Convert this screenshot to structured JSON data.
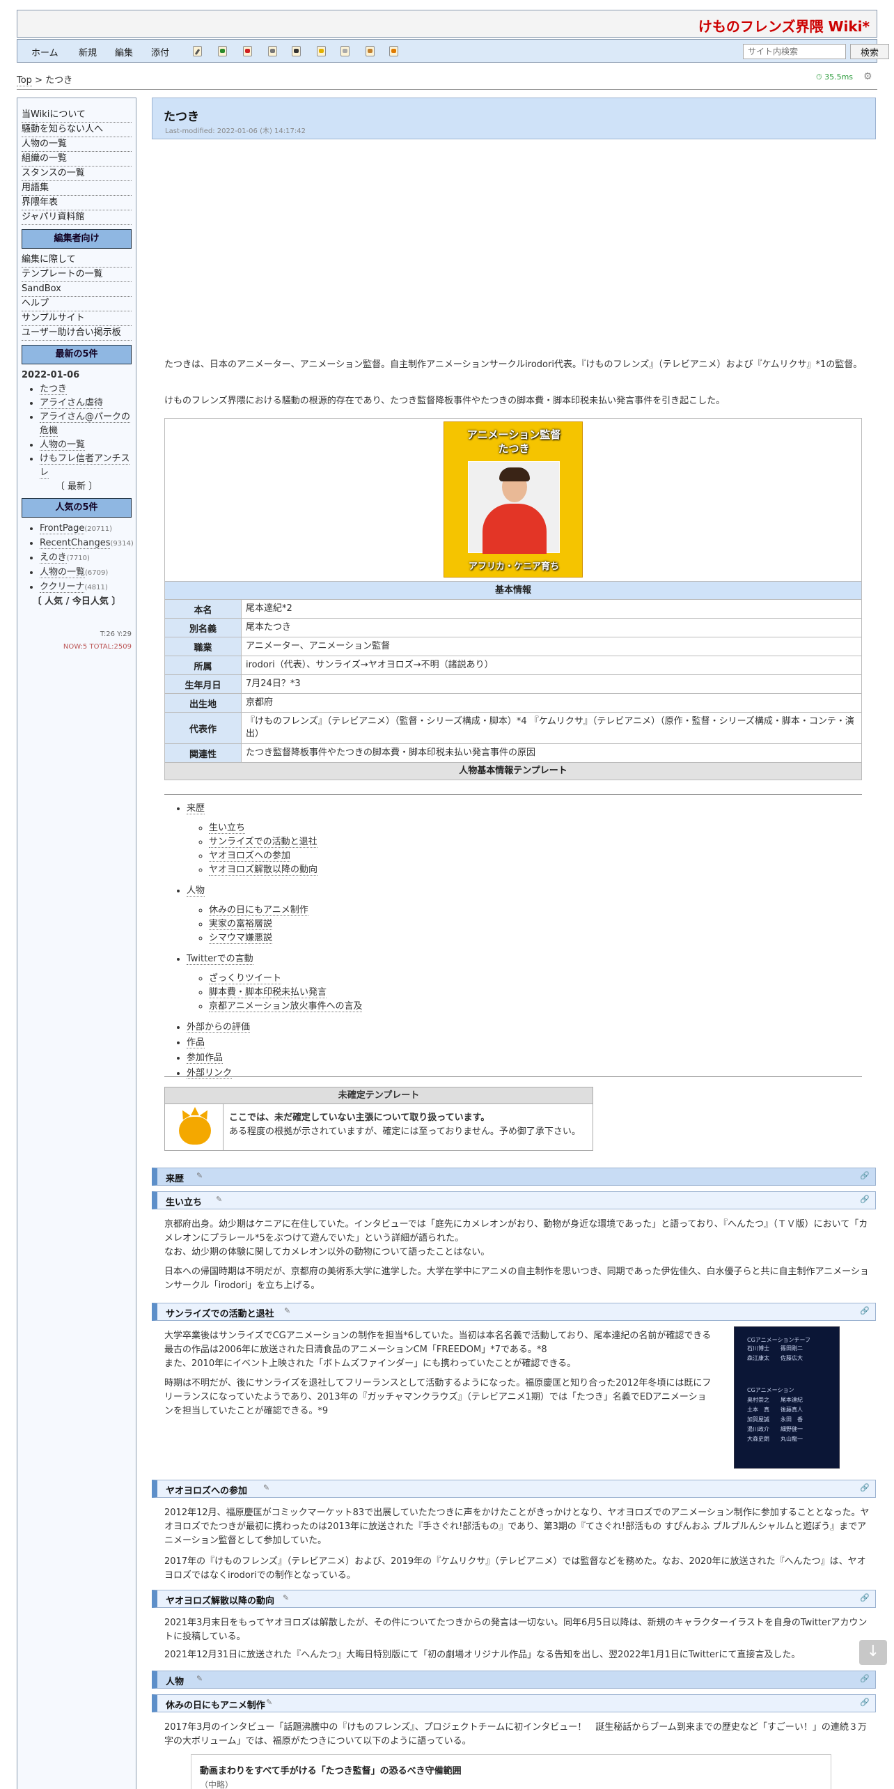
{
  "site": {
    "title": "けものフレンズ界隈 Wiki*"
  },
  "nav": {
    "home": "ホーム",
    "new": "新規",
    "edit": "編集",
    "attach": "添付",
    "search_placeholder": "サイト内検索",
    "search_button": "検索"
  },
  "breadcrumb": {
    "top": "Top",
    "sep": ">",
    "current": "たつき"
  },
  "perf": "35.5ms",
  "sidebar": {
    "links": [
      "当Wikiについて",
      "騒動を知らない人へ",
      "人物の一覧",
      "組織の一覧",
      "スタンスの一覧",
      "用語集",
      "界隈年表",
      "ジャパリ資料館"
    ],
    "editor_head": "編集者向け",
    "editor_links": [
      "編集に際して",
      "テンプレートの一覧",
      "SandBox",
      "ヘルプ",
      "サンプルサイト",
      "ユーザー助け合い掲示板"
    ],
    "latest_head": "最新の5件",
    "latest_date": "2022-01-06",
    "latest_items": [
      "たつき",
      "アライさん虐待",
      "アライさん@パークの危機",
      "人物の一覧",
      "けもフレ信者アンチスレ"
    ],
    "latest_more": "〔 最新 〕",
    "popular_head": "人気の5件",
    "popular_items": [
      {
        "name": "FrontPage",
        "count": "(20711)"
      },
      {
        "name": "RecentChanges",
        "count": "(9314)"
      },
      {
        "name": "えのき",
        "count": "(7710)"
      },
      {
        "name": "人物の一覧",
        "count": "(6709)"
      },
      {
        "name": "ククリーナ",
        "count": "(4811)"
      }
    ],
    "popular_more": "〔 人気 / 今日人気 〕",
    "counter1": "T:26 Y:29",
    "counter2": "NOW:5 TOTAL:2509"
  },
  "page": {
    "title": "たつき",
    "last_modified": "Last-modified: 2022-01-06 (木) 14:17:42",
    "intro1": "たつきは、日本のアニメーター、アニメーション監督。自主制作アニメーションサークルirodori代表。『けものフレンズ』（テレビアニメ）および『ケムリクサ』*1の監督。",
    "intro2": "けものフレンズ界隈における騒動の根源的存在であり、たつき監督降板事件やたつきの脚本費・脚本印税未払い発言事件を引き起こした。"
  },
  "poster": {
    "line1": "アニメーション監督",
    "line2": "たつき",
    "bottom": "アフリカ・ケニア育ち"
  },
  "infobox": {
    "head": "基本情報",
    "rows": [
      {
        "k": "本名",
        "v": "尾本達紀*2"
      },
      {
        "k": "別名義",
        "v": "尾本たつき"
      },
      {
        "k": "職業",
        "v": "アニメーター、アニメーション監督"
      },
      {
        "k": "所属",
        "v": "irodori（代表）、サンライズ→ヤオヨロズ→不明（諸説あり）"
      },
      {
        "k": "生年月日",
        "v": "7月24日？*3"
      },
      {
        "k": "出生地",
        "v": "京都府"
      },
      {
        "k": "代表作",
        "v": "『けものフレンズ』（テレビアニメ）（監督・シリーズ構成・脚本）*4 『ケムリクサ』（テレビアニメ）（原作・監督・シリーズ構成・脚本・コンテ・演出）"
      },
      {
        "k": "関連性",
        "v": "たつき監督降板事件やたつきの脚本費・脚本印税未払い発言事件の原因"
      }
    ],
    "foot": "人物基本情報テンプレート"
  },
  "toc": [
    {
      "label": "来歴",
      "sub": [
        "生い立ち",
        "サンライズでの活動と退社",
        "ヤオヨロズへの参加",
        "ヤオヨロズ解散以降の動向"
      ]
    },
    {
      "label": "人物",
      "sub": [
        "休みの日にもアニメ制作",
        "実家の富裕層説",
        "シマウマ嫌悪説"
      ]
    },
    {
      "label": "Twitterでの言動",
      "sub": [
        "ざっくりツイート",
        "脚本費・脚本印税未払い発言",
        "京都アニメーション放火事件への言及"
      ]
    },
    {
      "label": "外部からの評価",
      "sub": []
    },
    {
      "label": "作品",
      "sub": []
    },
    {
      "label": "参加作品",
      "sub": []
    },
    {
      "label": "外部リンク",
      "sub": []
    }
  ],
  "unconfirmed": {
    "head": "未確定テンプレート",
    "bold": "ここでは、未だ確定していない主張について取り扱っています。",
    "text": "ある程度の根拠が示されていますが、確定には至っておりません。予め御了承下さい。"
  },
  "sections": {
    "raireki": "来歴",
    "oitachi": "生い立ち",
    "oitachi_p1": "京都府出身。幼少期はケニアに在住していた。インタビューでは「庭先にカメレオンがおり、動物が身近な環境であった」と語っており、『へんたつ』（ＴＶ版）において「カメレオンにプラレール*5をぶつけて遊んでいた」という詳細が語られた。",
    "oitachi_p2": "なお、幼少期の体験に関してカメレオン以外の動物について語ったことはない。",
    "oitachi_p3": "日本への帰国時期は不明だが、京都府の美術系大学に進学した。大学在学中にアニメの自主制作を思いつき、同期であった伊佐佳久、白水優子らと共に自主制作アニメーションサークル「irodori」を立ち上げる。",
    "sunrise": "サンライズでの活動と退社",
    "sunrise_p1": "大学卒業後はサンライズでCGアニメーションの制作を担当*6していた。当初は本名名義で活動しており、尾本達紀の名前が確認できる最古の作品は2006年に放送された日清食品のアニメーションCM「FREEDOM」*7である。*8",
    "sunrise_p2": "また、2010年にイベント上映された「ボトムズファインダー」にも携わっていたことが確認できる。",
    "sunrise_p3": "時期は不明だが、後にサンライズを退社してフリーランスとして活動するようになった。福原慶匡と知り合った2012年冬頃には既にフリーランスになっていたようであり、2013年の『ガッチャマンクラウズ』（テレビアニメ1期）では「たつき」名義でEDアニメーションを担当していたことが確認できる。*9",
    "yaoyorozu": "ヤオヨロズへの参加",
    "yaoyorozu_p1": "2012年12月、福原慶匡がコミックマーケット83で出展していたたつきに声をかけたことがきっかけとなり、ヤオヨロズでのアニメーション制作に参加することとなった。ヤオヨロズでたつきが最初に携わったのは2013年に放送された『手さぐれ!部活もの』であり、第3期の『てさぐれ!部活もの すぴんおふ プルプルんシャルムと遊ぼう』までアニメーション監督として参加していた。",
    "yaoyorozu_p2": "2017年の『けものフレンズ』（テレビアニメ）および、2019年の『ケムリクサ』（テレビアニメ）では監督などを務めた。なお、2020年に放送された『へんたつ』は、ヤオヨロズではなくirodoriでの制作となっている。",
    "after": "ヤオヨロズ解散以降の動向",
    "after_p1": "2021年3月末日をもってヤオヨロズは解散したが、その件についてたつきからの発言は一切ない。同年6月5日以降は、新規のキャラクターイラストを自身のTwitterアカウントに投稿している。",
    "after_p2": "2021年12月31日に放送された『へんたつ』大晦日特別版にて「初の劇場オリジナル作品」なる告知を出し、翌2022年1月1日にTwitterにて直接言及した。",
    "jinbutsu": "人物",
    "yasumi": "休みの日にもアニメ制作",
    "yasumi_p1": "2017年3月のインタビュー「話題沸騰中の『けものフレンズ』、プロジェクトチームに初インタビュー！　誕生秘話からブーム到来までの歴史など「すごーい！」の連続３万字の大ボリューム」では、福原がたつきについて以下のように語っている。",
    "quote_title": "動画まわりをすべて手がける「たつき監督」の恐るべき守備範囲",
    "quote_sub": "（中略）"
  },
  "credits": {
    "lines": [
      "CGアニメーションチーフ",
      "石川博士　　篠田剛二",
      "森江康太　　佐藤広大",
      "",
      "CGアニメーション",
      "奥村崇之　　尾本達紀",
      "土本　真　　後藤真人",
      "加賀屋誠　　永田　香",
      "湯川政介　　細野健一",
      "大森史朗　　丸山龍一"
    ]
  },
  "colors": {
    "accent": "#5d8fc9",
    "title_red": "#cc0000",
    "panel": "#cfe2f8"
  }
}
